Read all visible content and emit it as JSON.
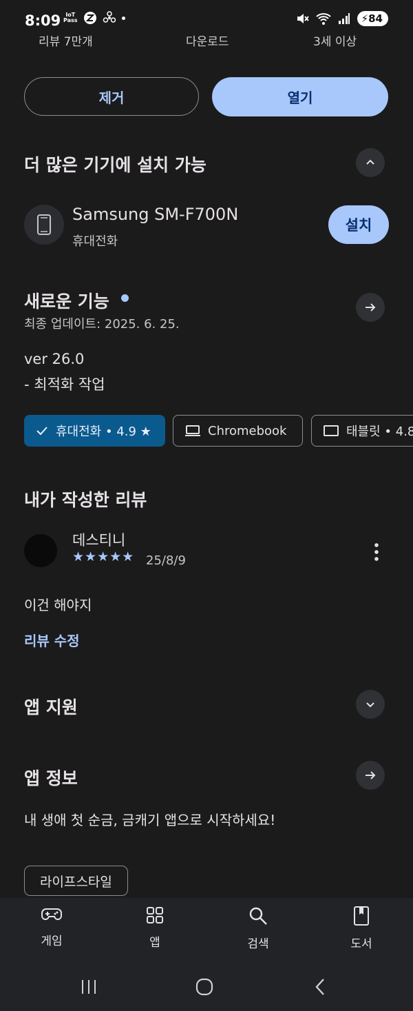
{
  "status_bar": {
    "time": "8:09",
    "iot_label": "IoT",
    "pass_label": "Pass",
    "battery": "84"
  },
  "stats_row": {
    "reviews": "리뷰 7만개",
    "downloads": "다운로드",
    "age": "3세 이상"
  },
  "actions": {
    "uninstall_label": "제거",
    "open_label": "열기"
  },
  "more_devices": {
    "title": "더 많은 기기에 설치 가능",
    "device_name": "Samsung SM-F700N",
    "device_type": "휴대전화",
    "install_label": "설치"
  },
  "whats_new": {
    "title": "새로운 기능",
    "last_updated": "최종 업데이트: 2025. 6. 25.",
    "version": "ver 26.0",
    "note": "- 최적화 작업"
  },
  "device_chips": {
    "phone": "휴대전화 • 4.9 ★",
    "chromebook": "Chromebook",
    "tablet": "태블릿 • 4.8"
  },
  "my_review": {
    "title": "내가 작성한 리뷰",
    "reviewer": "데스티니",
    "stars": "★★★★★",
    "date": "25/8/9",
    "text": "이건 해야지",
    "edit_label": "리뷰 수정"
  },
  "app_support": {
    "title": "앱 지원"
  },
  "app_info": {
    "title": "앱 정보",
    "description": "내 생애 첫 순금, 금캐기 앱으로 시작하세요!",
    "tag": "라이프스타일"
  },
  "bottom_nav": {
    "items": [
      "게임",
      "앱",
      "검색",
      "도서"
    ]
  },
  "colors": {
    "background": "#1b1b1c",
    "accent": "#a8c7fa",
    "chip_selected": "#0b5a8d"
  }
}
